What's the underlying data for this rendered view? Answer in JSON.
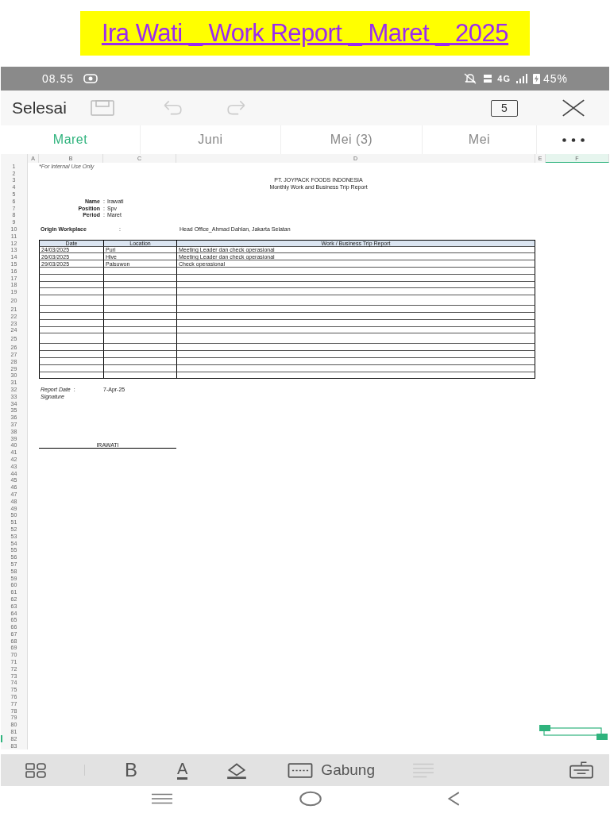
{
  "document_title": "Ira Wati _ Work Report _ Maret _ 2025",
  "status_bar": {
    "time": "08.55",
    "network": "4G",
    "battery": "45%"
  },
  "toolbar": {
    "done_label": "Selesai",
    "undo_enabled": false,
    "redo_enabled": false,
    "sheet_count": "5"
  },
  "tabs": [
    {
      "label": "Maret",
      "selected": true
    },
    {
      "label": "Juni",
      "selected": false
    },
    {
      "label": "Mei (3)",
      "selected": false
    },
    {
      "label": "Mei",
      "selected": false
    }
  ],
  "columns": [
    {
      "label": "A",
      "selected": false
    },
    {
      "label": "B",
      "selected": false
    },
    {
      "label": "C",
      "selected": false
    },
    {
      "label": "D",
      "selected": false
    },
    {
      "label": "E",
      "selected": false
    },
    {
      "label": "F",
      "selected": true
    }
  ],
  "rows": [
    {
      "number": "1",
      "kind": "note",
      "note": "*For Internal Use Only"
    },
    {
      "number": "2",
      "kind": "blank"
    },
    {
      "number": "3",
      "kind": "title",
      "heading": "PT. JOYPACK FOODS INDONESIA"
    },
    {
      "number": "4",
      "kind": "title",
      "heading": "Monthly Work and Business Trip Report"
    },
    {
      "number": "5",
      "kind": "blank"
    },
    {
      "number": "6",
      "kind": "field",
      "label": "Name",
      "separator": ":",
      "value": "Irawati"
    },
    {
      "number": "7",
      "kind": "field",
      "label": "Position",
      "separator": ":",
      "value": "Spv"
    },
    {
      "number": "8",
      "kind": "field",
      "label": "Period",
      "separator": ":",
      "value": "Maret"
    },
    {
      "number": "9",
      "kind": "blank"
    },
    {
      "number": "10",
      "kind": "origin",
      "origin_label": "Origin Workplace",
      "origin_separator": ":",
      "workplace": "Head Office_Ahmad Dahlan, Jakarta Selatan"
    },
    {
      "number": "11",
      "kind": "blank"
    },
    {
      "number": "12",
      "kind": "table_header",
      "cells": [
        "Date",
        "Location",
        "Work / Business Trip Report"
      ]
    },
    {
      "number": "13",
      "kind": "table_row",
      "cells": [
        "24/03/2025",
        "Puri",
        "Meeting Leader dan check operasional"
      ]
    },
    {
      "number": "14",
      "kind": "table_row",
      "cells": [
        "26/03/2025",
        "Hive",
        "Meeting Leader dan check operasional"
      ]
    },
    {
      "number": "15",
      "kind": "table_row",
      "cells": [
        "29/03/2025",
        "Palsuwon",
        "Check operasional"
      ]
    },
    {
      "number": "16",
      "kind": "table_row"
    },
    {
      "number": "17",
      "kind": "table_row"
    },
    {
      "number": "18",
      "kind": "table_row"
    },
    {
      "number": "19",
      "kind": "table_row"
    },
    {
      "number": "20",
      "kind": "table_row",
      "tall": true
    },
    {
      "number": "21",
      "kind": "table_row"
    },
    {
      "number": "22",
      "kind": "table_row"
    },
    {
      "number": "23",
      "kind": "table_row"
    },
    {
      "number": "24",
      "kind": "table_row"
    },
    {
      "number": "25",
      "kind": "table_row",
      "tall": true
    },
    {
      "number": "26",
      "kind": "table_row"
    },
    {
      "number": "27",
      "kind": "table_row"
    },
    {
      "number": "28",
      "kind": "table_row"
    },
    {
      "number": "29",
      "kind": "table_row"
    },
    {
      "number": "30",
      "kind": "table_row",
      "last": true
    },
    {
      "number": "31",
      "kind": "blank"
    },
    {
      "number": "32",
      "kind": "report_date",
      "date_label": "Report Date",
      "date_separator": ":",
      "date_value": "7-Apr-25"
    },
    {
      "number": "33",
      "kind": "signature_label",
      "caption": "Signature"
    },
    {
      "number": "34",
      "kind": "blank"
    },
    {
      "number": "35",
      "kind": "blank"
    },
    {
      "number": "36",
      "kind": "blank"
    },
    {
      "number": "37",
      "kind": "blank"
    },
    {
      "number": "38",
      "kind": "blank"
    },
    {
      "number": "39",
      "kind": "blank"
    },
    {
      "number": "40",
      "kind": "signature_name",
      "signer": "IRAWATI"
    },
    {
      "number": "41",
      "kind": "blank"
    },
    {
      "number": "42",
      "kind": "blank"
    },
    {
      "number": "43",
      "kind": "blank"
    },
    {
      "number": "44",
      "kind": "blank"
    },
    {
      "number": "45",
      "kind": "blank"
    },
    {
      "number": "46",
      "kind": "blank"
    },
    {
      "number": "47",
      "kind": "blank"
    },
    {
      "number": "48",
      "kind": "blank"
    },
    {
      "number": "49",
      "kind": "blank"
    },
    {
      "number": "50",
      "kind": "blank"
    },
    {
      "number": "51",
      "kind": "blank"
    },
    {
      "number": "52",
      "kind": "blank"
    },
    {
      "number": "53",
      "kind": "blank"
    },
    {
      "number": "54",
      "kind": "blank"
    },
    {
      "number": "55",
      "kind": "blank"
    },
    {
      "number": "56",
      "kind": "blank"
    },
    {
      "number": "57",
      "kind": "blank"
    },
    {
      "number": "58",
      "kind": "blank"
    },
    {
      "number": "59",
      "kind": "blank"
    },
    {
      "number": "60",
      "kind": "blank"
    },
    {
      "number": "61",
      "kind": "blank"
    },
    {
      "number": "62",
      "kind": "blank"
    },
    {
      "number": "63",
      "kind": "blank"
    },
    {
      "number": "64",
      "kind": "blank"
    },
    {
      "number": "65",
      "kind": "blank"
    },
    {
      "number": "66",
      "kind": "blank"
    },
    {
      "number": "67",
      "kind": "blank"
    },
    {
      "number": "68",
      "kind": "blank"
    },
    {
      "number": "69",
      "kind": "blank"
    },
    {
      "number": "70",
      "kind": "blank"
    },
    {
      "number": "71",
      "kind": "blank"
    },
    {
      "number": "72",
      "kind": "blank"
    },
    {
      "number": "73",
      "kind": "blank"
    },
    {
      "number": "74",
      "kind": "blank"
    },
    {
      "number": "75",
      "kind": "blank"
    },
    {
      "number": "76",
      "kind": "blank"
    },
    {
      "number": "77",
      "kind": "blank"
    },
    {
      "number": "78",
      "kind": "blank"
    },
    {
      "number": "79",
      "kind": "blank"
    },
    {
      "number": "80",
      "kind": "blank"
    },
    {
      "number": "81",
      "kind": "blank"
    },
    {
      "number": "82",
      "kind": "blank",
      "selected": true
    },
    {
      "number": "83",
      "kind": "blank"
    }
  ],
  "bottom_toolbar": {
    "bold_label": "B",
    "color_label": "A",
    "merge_label": "Gabung",
    "align_enabled": false
  }
}
